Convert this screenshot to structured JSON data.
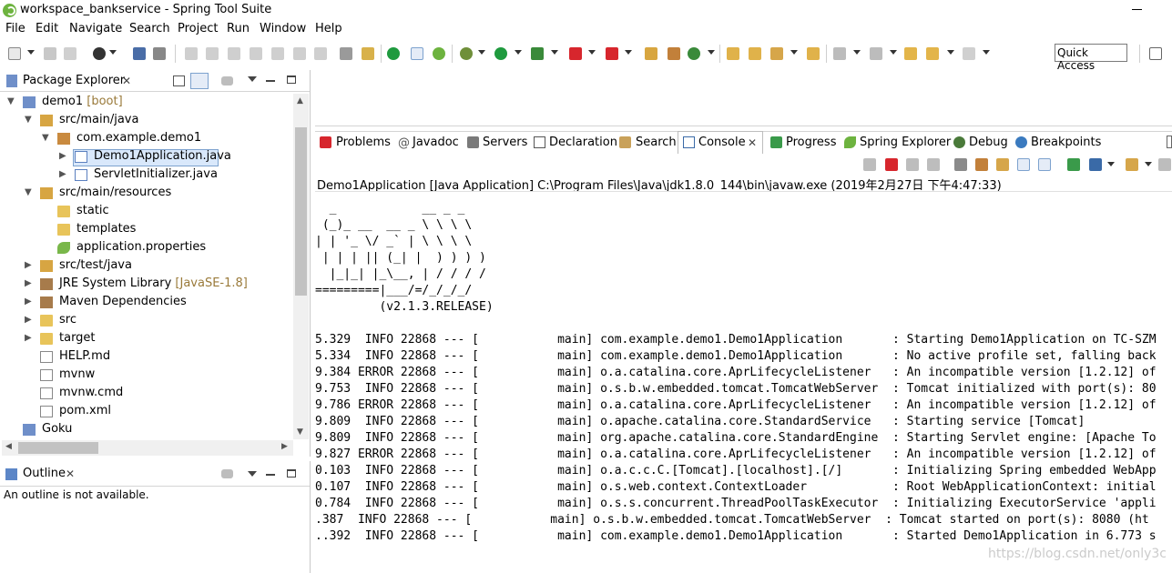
{
  "window": {
    "title": "workspace_bankservice - Spring Tool Suite",
    "minimize_glyph": "—"
  },
  "menu": [
    "File",
    "Edit",
    "Navigate",
    "Search",
    "Project",
    "Run",
    "Window",
    "Help"
  ],
  "toolbar": {
    "quick_access_label": "Quick Access"
  },
  "package_explorer": {
    "tab_label": "Package Explorer",
    "close_glyph": "✕",
    "tree": [
      {
        "label": "demo1",
        "decoration": " [boot]",
        "indent": 0,
        "expanded": true,
        "icon": "project-icon"
      },
      {
        "label": "src/main/java",
        "decoration": "",
        "indent": 1,
        "expanded": true,
        "icon": "source-folder-icon"
      },
      {
        "label": "com.example.demo1",
        "decoration": "",
        "indent": 2,
        "expanded": true,
        "icon": "package-icon"
      },
      {
        "label": "Demo1Application.java",
        "decoration": "",
        "indent": 3,
        "expanded": false,
        "icon": "java-file-icon",
        "selected": true
      },
      {
        "label": "ServletInitializer.java",
        "decoration": "",
        "indent": 3,
        "expanded": false,
        "icon": "java-file-icon"
      },
      {
        "label": "src/main/resources",
        "decoration": "",
        "indent": 1,
        "expanded": true,
        "icon": "source-folder-icon"
      },
      {
        "label": "static",
        "decoration": "",
        "indent": 2,
        "expanded": null,
        "icon": "folder-icon"
      },
      {
        "label": "templates",
        "decoration": "",
        "indent": 2,
        "expanded": null,
        "icon": "folder-icon"
      },
      {
        "label": "application.properties",
        "decoration": "",
        "indent": 2,
        "expanded": null,
        "icon": "properties-file-icon"
      },
      {
        "label": "src/test/java",
        "decoration": "",
        "indent": 1,
        "expanded": false,
        "icon": "source-folder-icon"
      },
      {
        "label": "JRE System Library",
        "decoration": " [JavaSE-1.8]",
        "indent": 1,
        "expanded": false,
        "icon": "library-icon"
      },
      {
        "label": "Maven Dependencies",
        "decoration": "",
        "indent": 1,
        "expanded": false,
        "icon": "library-icon"
      },
      {
        "label": "src",
        "decoration": "",
        "indent": 1,
        "expanded": false,
        "icon": "folder-icon"
      },
      {
        "label": "target",
        "decoration": "",
        "indent": 1,
        "expanded": false,
        "icon": "folder-icon"
      },
      {
        "label": "HELP.md",
        "decoration": "",
        "indent": 1,
        "expanded": null,
        "icon": "file-icon"
      },
      {
        "label": "mvnw",
        "decoration": "",
        "indent": 1,
        "expanded": null,
        "icon": "file-icon"
      },
      {
        "label": "mvnw.cmd",
        "decoration": "",
        "indent": 1,
        "expanded": null,
        "icon": "file-icon"
      },
      {
        "label": "pom.xml",
        "decoration": "",
        "indent": 1,
        "expanded": null,
        "icon": "xml-file-icon"
      },
      {
        "label": "Goku",
        "decoration": "",
        "indent": 0,
        "expanded": null,
        "icon": "project-icon"
      }
    ]
  },
  "outline": {
    "tab_label": "Outline",
    "close_glyph": "✕",
    "message": "An outline is not available."
  },
  "console_tabs": [
    {
      "label": "Problems",
      "icon": "problems-icon"
    },
    {
      "label": "Javadoc",
      "icon": "javadoc-icon"
    },
    {
      "label": "Servers",
      "icon": "servers-icon"
    },
    {
      "label": "Declaration",
      "icon": "declaration-icon"
    },
    {
      "label": "Search",
      "icon": "search-icon"
    },
    {
      "label": "Console",
      "icon": "console-icon",
      "active": true
    },
    {
      "label": "Progress",
      "icon": "progress-icon"
    },
    {
      "label": "Spring Explorer",
      "icon": "spring-icon"
    },
    {
      "label": "Debug",
      "icon": "debug-icon"
    },
    {
      "label": "Breakpoints",
      "icon": "breakpoints-icon"
    }
  ],
  "console": {
    "description": "Demo1Application [Java Application] C:\\Program Files\\Java\\jdk1.8.0_144\\bin\\javaw.exe (2019年2月27日 下午4:47:33)",
    "banner": [
      "  _            __ _ _",
      " (_)_ __  __ _ \\ \\ \\ \\",
      "| | '_ \\/ _` | \\ \\ \\ \\",
      " | | | || (_| |  ) ) ) )",
      "  |_|_| |_\\__, | / / / /",
      "=========|___/=/_/_/_/",
      "         (v2.1.3.RELEASE)"
    ],
    "log_lines": [
      "5.329  INFO 22868 --- [           main] com.example.demo1.Demo1Application       : Starting Demo1Application on TC-SZM",
      "5.334  INFO 22868 --- [           main] com.example.demo1.Demo1Application       : No active profile set, falling back",
      "9.384 ERROR 22868 --- [           main] o.a.catalina.core.AprLifecycleListener   : An incompatible version [1.2.12] of",
      "9.753  INFO 22868 --- [           main] o.s.b.w.embedded.tomcat.TomcatWebServer  : Tomcat initialized with port(s): 80",
      "9.786 ERROR 22868 --- [           main] o.a.catalina.core.AprLifecycleListener   : An incompatible version [1.2.12] of",
      "9.809  INFO 22868 --- [           main] o.apache.catalina.core.StandardService   : Starting service [Tomcat]",
      "9.809  INFO 22868 --- [           main] org.apache.catalina.core.StandardEngine  : Starting Servlet engine: [Apache To",
      "9.827 ERROR 22868 --- [           main] o.a.catalina.core.AprLifecycleListener   : An incompatible version [1.2.12] of",
      "0.103  INFO 22868 --- [           main] o.a.c.c.C.[Tomcat].[localhost].[/]       : Initializing Spring embedded WebApp",
      "0.107  INFO 22868 --- [           main] o.s.web.context.ContextLoader            : Root WebApplicationContext: initial",
      "0.784  INFO 22868 --- [           main] o.s.s.concurrent.ThreadPoolTaskExecutor  : Initializing ExecutorService 'appli",
      ".387  INFO 22868 --- [           main] o.s.b.w.embedded.tomcat.TomcatWebServer  : Tomcat started on port(s): 8080 (ht",
      "..392  INFO 22868 --- [           main] com.example.demo1.Demo1Application       : Started Demo1Application in 6.773 s"
    ],
    "watermark": "https://blog.csdn.net/only3c"
  },
  "colors": {
    "selection_bg": "#d9e8fb",
    "decoration_text": "#9a7a3a",
    "spring_green": "#6db33f"
  }
}
